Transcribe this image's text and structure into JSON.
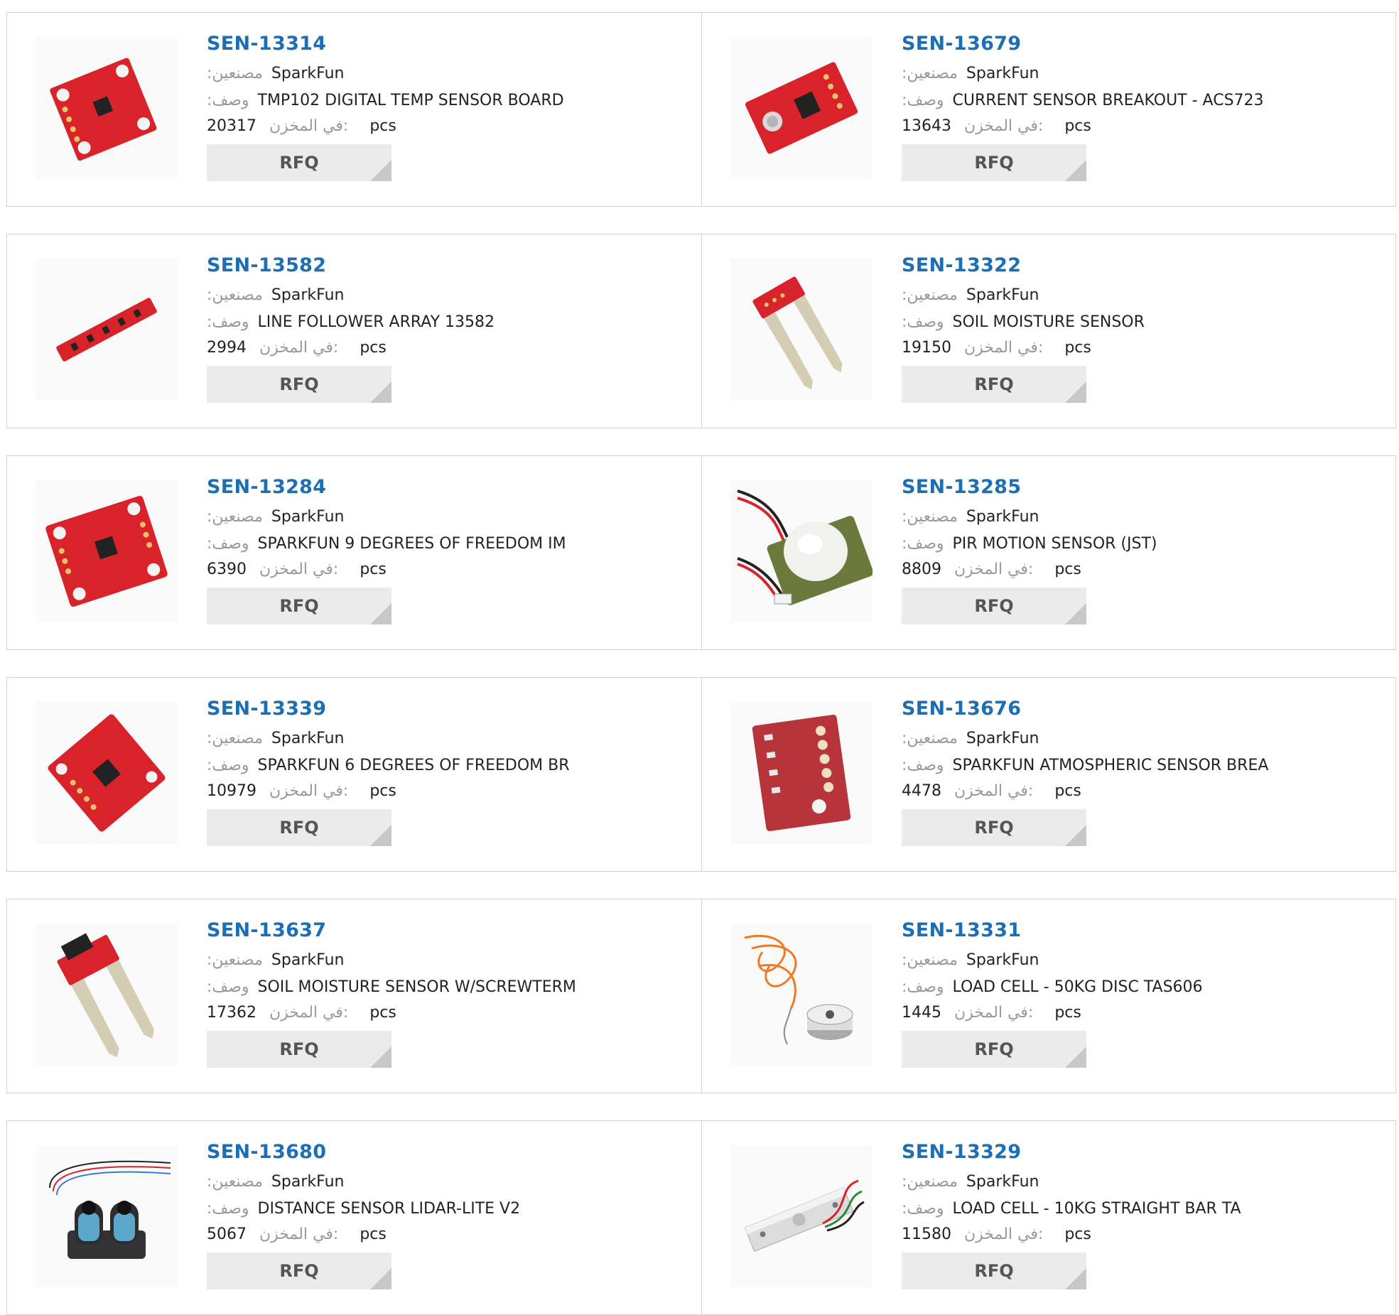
{
  "labels": {
    "manufacturer": ":مصنعين",
    "description": ":وصف",
    "stock": "في المخزن:",
    "unit": "pcs",
    "rfq": "RFQ"
  },
  "products": [
    {
      "part": "SEN-13314",
      "mfr": "SparkFun",
      "desc": "TMP102 DIGITAL TEMP SENSOR BOARD",
      "stock": "20317",
      "image": "red-breakout-board"
    },
    {
      "part": "SEN-13679",
      "mfr": "SparkFun",
      "desc": "CURRENT SENSOR BREAKOUT - ACS723",
      "stock": "13643",
      "image": "red-breakout-board"
    },
    {
      "part": "SEN-13582",
      "mfr": "SparkFun",
      "desc": "LINE FOLLOWER ARRAY 13582",
      "stock": "2994",
      "image": "red-strip-board"
    },
    {
      "part": "SEN-13322",
      "mfr": "SparkFun",
      "desc": "SOIL MOISTURE SENSOR",
      "stock": "19150",
      "image": "soil-probe"
    },
    {
      "part": "SEN-13284",
      "mfr": "SparkFun",
      "desc": "SPARKFUN 9 DEGREES OF FREEDOM IM",
      "stock": "6390",
      "image": "red-breakout-board"
    },
    {
      "part": "SEN-13285",
      "mfr": "SparkFun",
      "desc": "PIR MOTION SENSOR (JST)",
      "stock": "8809",
      "image": "pir-dome"
    },
    {
      "part": "SEN-13339",
      "mfr": "SparkFun",
      "desc": "SPARKFUN 6 DEGREES OF FREEDOM BR",
      "stock": "10979",
      "image": "red-breakout-board"
    },
    {
      "part": "SEN-13676",
      "mfr": "SparkFun",
      "desc": "SPARKFUN ATMOSPHERIC SENSOR BREA",
      "stock": "4478",
      "image": "red-breakout-board"
    },
    {
      "part": "SEN-13637",
      "mfr": "SparkFun",
      "desc": "SOIL MOISTURE SENSOR W/SCREWTERM",
      "stock": "17362",
      "image": "soil-probe"
    },
    {
      "part": "SEN-13331",
      "mfr": "SparkFun",
      "desc": "LOAD CELL - 50KG DISC TAS606",
      "stock": "1445",
      "image": "disc-load-cell"
    },
    {
      "part": "SEN-13680",
      "mfr": "SparkFun",
      "desc": "DISTANCE SENSOR LIDAR-LITE V2",
      "stock": "5067",
      "image": "lidar"
    },
    {
      "part": "SEN-13329",
      "mfr": "SparkFun",
      "desc": "LOAD CELL - 10KG STRAIGHT BAR TA",
      "stock": "11580",
      "image": "bar-load-cell"
    }
  ]
}
